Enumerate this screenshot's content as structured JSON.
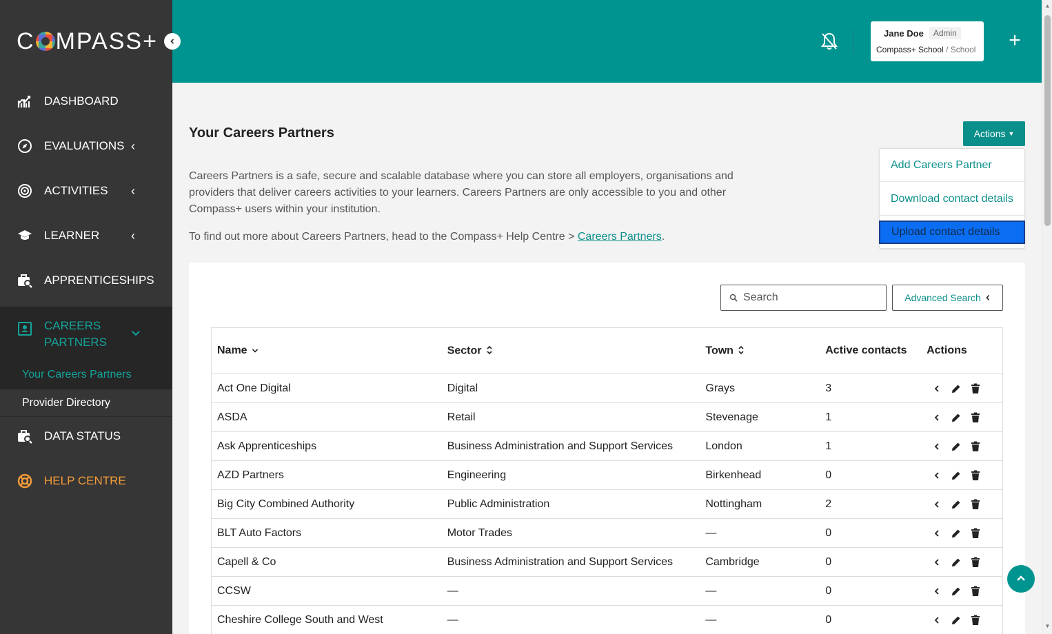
{
  "brand": {
    "logo_pre": "C",
    "logo_post": "MPASS+"
  },
  "sidebar": {
    "collapse_icon": "chevron-left-icon",
    "items": [
      {
        "label": "DASHBOARD",
        "icon": "chart-icon"
      },
      {
        "label": "EVALUATIONS",
        "icon": "compass-icon"
      },
      {
        "label": "ACTIVITIES",
        "icon": "target-icon"
      },
      {
        "label": "LEARNER",
        "icon": "graduation-cap-icon"
      },
      {
        "label": "APPRENTICESHIPS",
        "icon": "briefcase-search-icon"
      },
      {
        "label": "CAREERS PARTNERS",
        "icon": "contact-card-icon"
      },
      {
        "label": "DATA STATUS",
        "icon": "briefcase-search-icon"
      },
      {
        "label": "HELP CENTRE",
        "icon": "lifebuoy-icon"
      }
    ],
    "sub_items": [
      {
        "label": "Your Careers Partners"
      },
      {
        "label": "Provider Directory"
      }
    ]
  },
  "header": {
    "user_name": "Jane Doe",
    "user_role": "Admin",
    "org": "Compass+ School",
    "org_type": "School"
  },
  "page": {
    "title": "Your Careers Partners",
    "actions_label": "Actions",
    "actions_menu": [
      {
        "label": "Add Careers Partner"
      },
      {
        "label": "Download contact details"
      },
      {
        "label": "Upload contact details"
      }
    ],
    "description": "Careers Partners is a safe, secure and scalable database where you can store all employers, organisations and providers that deliver careers activities to your learners. Careers Partners are only accessible to you and other Compass+ users within your institution.",
    "help_text": "To find out more about Careers Partners, head to the Compass+ Help Centre >",
    "help_link": "Careers Partners",
    "help_end": "."
  },
  "search": {
    "placeholder": "Search",
    "advanced_label": "Advanced Search"
  },
  "table": {
    "headers": {
      "name": "Name",
      "sector": "Sector",
      "town": "Town",
      "active": "Active contacts",
      "actions": "Actions"
    },
    "rows": [
      {
        "name": "Act One Digital",
        "sector": "Digital",
        "town": "Grays",
        "active": "3"
      },
      {
        "name": "ASDA",
        "sector": "Retail",
        "town": "Stevenage",
        "active": "1"
      },
      {
        "name": "Ask Apprenticeships",
        "sector": "Business Administration and Support Services",
        "town": "London",
        "active": "1"
      },
      {
        "name": "AZD Partners",
        "sector": "Engineering",
        "town": "Birkenhead",
        "active": "0"
      },
      {
        "name": "Big City Combined Authority",
        "sector": "Public Administration",
        "town": "Nottingham",
        "active": "2"
      },
      {
        "name": "BLT Auto Factors",
        "sector": "Motor Trades",
        "town": "—",
        "active": "0"
      },
      {
        "name": "Capell & Co",
        "sector": "Business Administration and Support Services",
        "town": "Cambridge",
        "active": "0"
      },
      {
        "name": "CCSW",
        "sector": "—",
        "town": "—",
        "active": "0"
      },
      {
        "name": "Cheshire College South and West",
        "sector": "—",
        "town": "—",
        "active": "0"
      }
    ]
  },
  "colors": {
    "teal": "#009490",
    "sidebar": "#363636",
    "active_nav": "#14a39a",
    "help": "#f29b3a",
    "selected": "#0a6df2"
  }
}
